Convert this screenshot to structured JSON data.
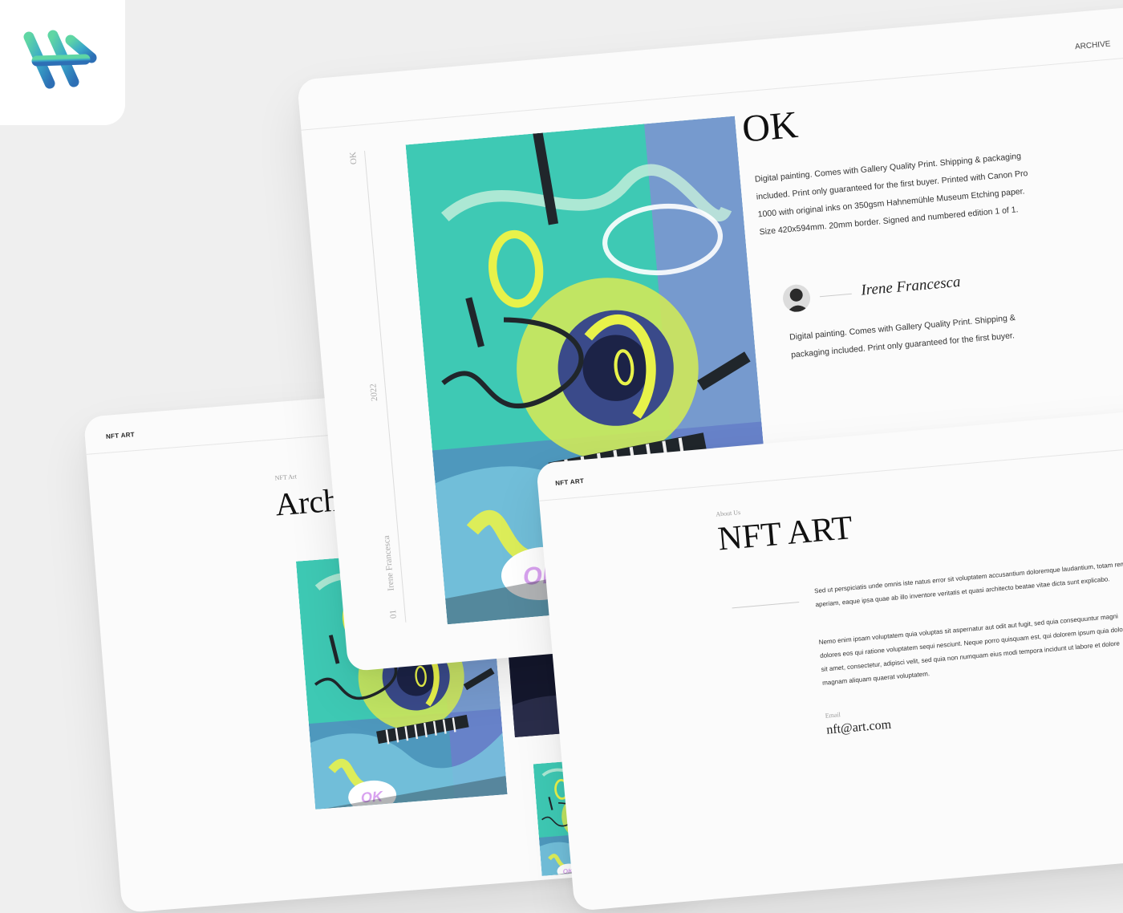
{
  "logo": {
    "icon": "brand-logo-icon",
    "gradient": [
      "#5fd6a4",
      "#3aa8c9",
      "#2d6fb5"
    ]
  },
  "archive_page": {
    "brand": "NFT ART",
    "eyebrow": "NFT Art",
    "title": "Archi"
  },
  "detail_page": {
    "nav_archive": "ARCHIVE",
    "side_title": "OK",
    "side_year": "2022",
    "side_artist": "Irene Francesca",
    "side_index": "01",
    "title": "OK",
    "description": "Digital painting. Comes with Gallery Quality Print. Shipping & packaging included. Print only guaranteed for the first buyer. Printed with Canon Pro 1000 with original inks on 350gsm Hahnemühle Museum Etching paper. Size 420x594mm. 20mm border. Signed and numbered edition 1 of 1.",
    "artist_name": "Irene Francesca",
    "artist_note": "Digital painting. Comes with Gallery Quality Print. Shipping & packaging included. Print only guaranteed for the first buyer."
  },
  "about_page": {
    "brand": "NFT ART",
    "eyebrow": "About Us",
    "title": "NFT ART",
    "paragraph_1": "Sed ut perspiciatis unde omnis iste natus error sit voluptatem accusantium doloremque laudantium, totam rem aperiam, eaque ipsa quae ab illo inventore veritatis et quasi architecto beatae vitae dicta sunt explicabo.",
    "paragraph_2": "Nemo enim ipsam voluptatem quia voluptas sit aspernatur aut odit aut fugit, sed quia consequuntur magni dolores eos qui ratione voluptatem sequi nesciunt. Neque porro quisquam est, qui dolorem ipsum quia dolor sit amet, consectetur, adipisci velit, sed quia non numquam eius modi tempora incidunt ut labore et dolore magnam aliquam quaerat voluptatem.",
    "email_label": "Email",
    "email": "nft@art.com"
  },
  "artwork": {
    "label": "OK",
    "colors": {
      "teal": "#3ec9b4",
      "yellow": "#e8f24a",
      "navy": "#1c2347",
      "purple": "#8f86d8",
      "pink": "#d9a3f0",
      "dark": "#20262b"
    }
  }
}
